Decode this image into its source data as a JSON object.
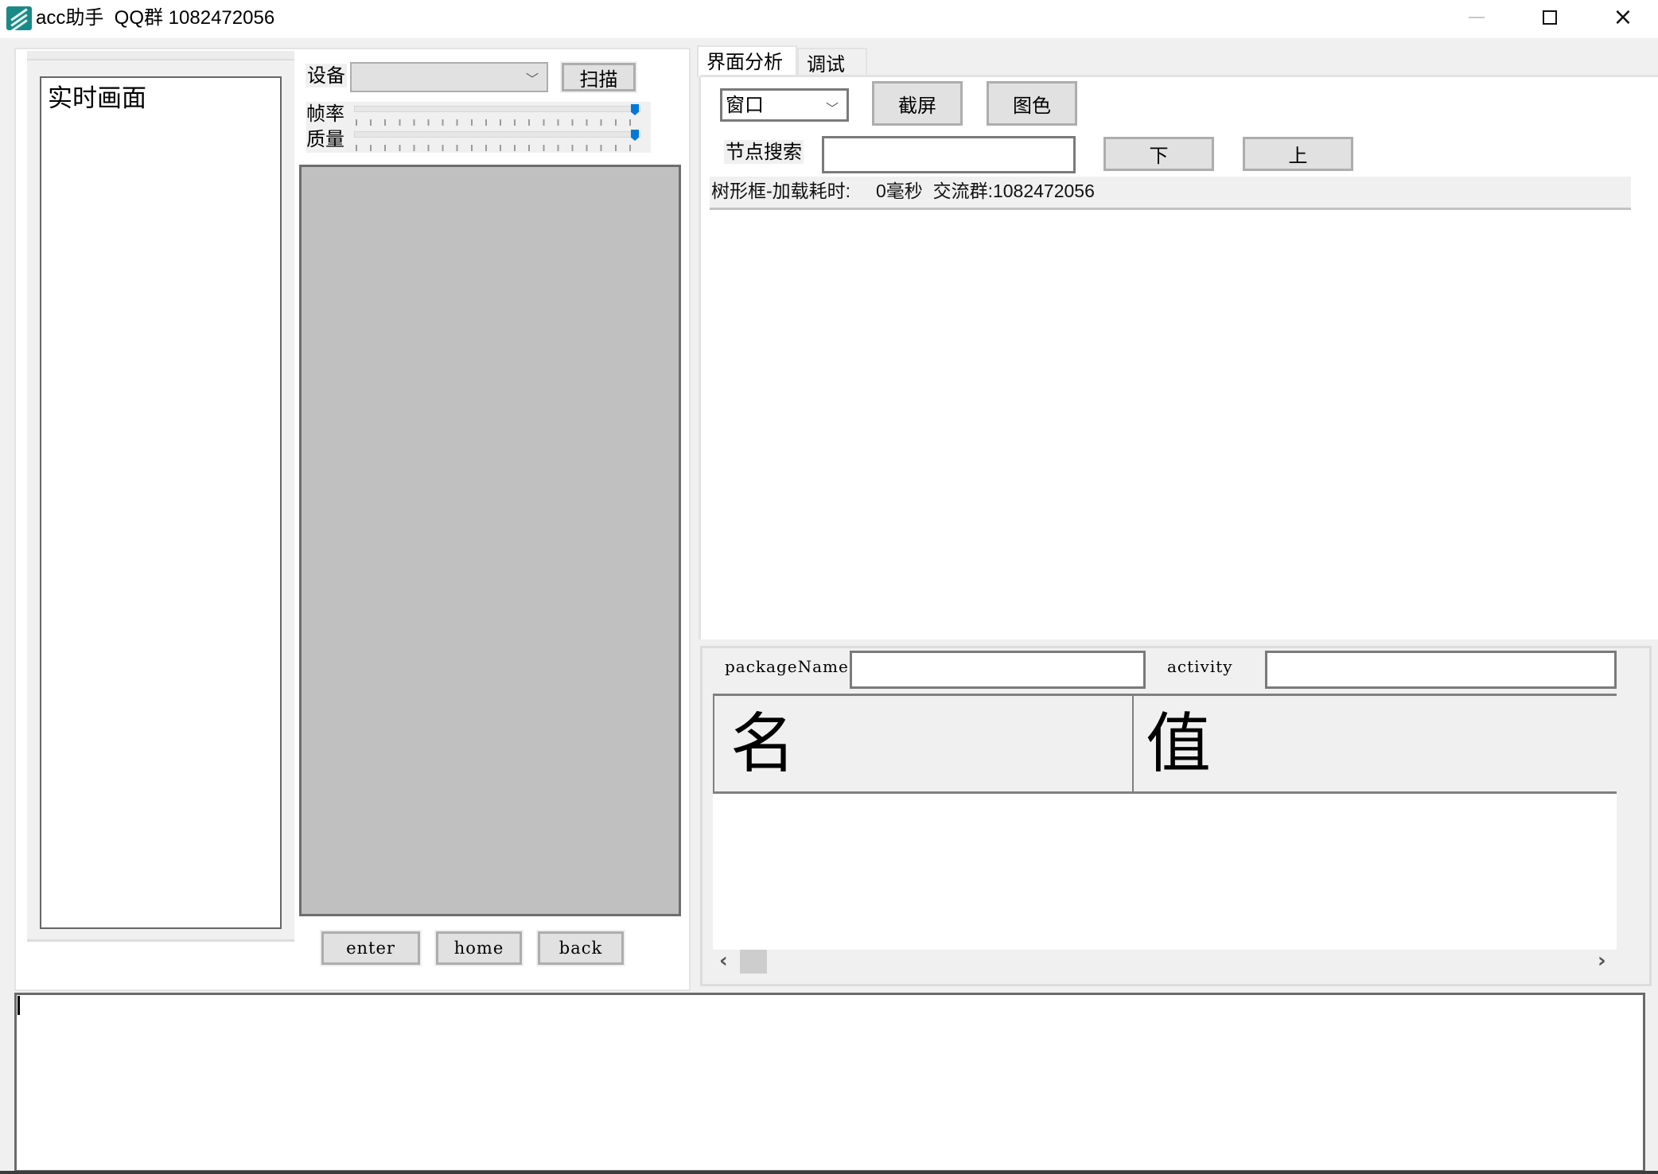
{
  "window": {
    "title": "acc助手  QQ群 1082472056",
    "icon": "app-logo-icon",
    "controls": {
      "minimize": "minimize-icon",
      "maximize": "maximize-icon",
      "close": "×"
    }
  },
  "left": {
    "preview_label": "实时画面",
    "device_label": "设备",
    "device_value": "",
    "scan_button": "扫描",
    "fps_label": "帧率",
    "fps_value_pct": 100,
    "quality_label": "质量",
    "quality_value_pct": 100,
    "buttons": [
      "enter",
      "home",
      "back"
    ]
  },
  "right": {
    "tabs": [
      {
        "label": "界面分析",
        "active": true
      },
      {
        "label": "调试",
        "active": false
      }
    ],
    "mode_select_value": "窗口",
    "screenshot_button": "截屏",
    "color_button": "图色",
    "node_search_label": "节点搜索",
    "node_search_value": "",
    "down_button": "下",
    "up_button": "上",
    "status_text": "树形框-加载耗时:     0毫秒  交流群:1082472056",
    "package_name_label": "packageName",
    "package_name_value": "",
    "activity_label": "activity",
    "activity_value": "",
    "grid_columns": [
      "名",
      "值"
    ],
    "grid_rows": [],
    "scroll_left": "‹",
    "scroll_right": "›"
  },
  "console": {
    "text": ""
  }
}
